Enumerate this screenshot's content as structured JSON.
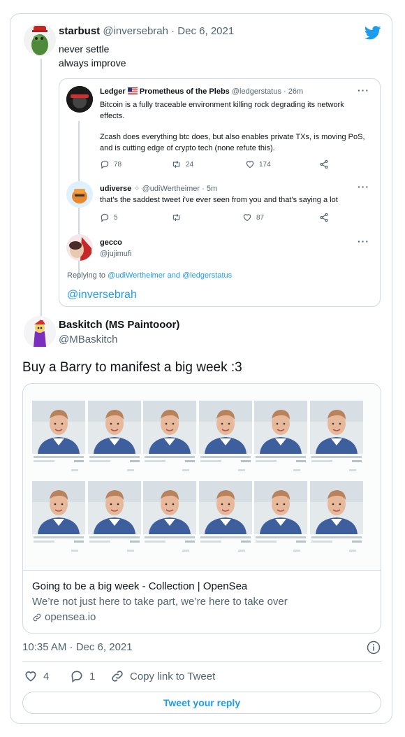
{
  "main_tweet": {
    "display_name": "starbust",
    "handle_date": "@inversebrah · Dec 6, 2021",
    "lines": [
      "never settle",
      "always improve"
    ]
  },
  "quoted_thread": {
    "tweet1": {
      "name_prefix": "Ledger",
      "name_suffix": "Prometheus of the Plebs",
      "handle_time": "@ledgerstatus · 26m",
      "text_para1": "Bitcoin is a fully traceable environment killing rock degrading its network effects.",
      "text_para2": "Zcash does everything btc does, but also enables private TXs, is moving PoS, and is cutting edge of crypto tech (none refute this).",
      "replies": "78",
      "retweets": "24",
      "likes": "174"
    },
    "tweet2": {
      "name": "udiverse",
      "handle_time": "@udiWertheimer · 5m",
      "text": "that's the saddest tweet i've ever seen from you and that's saying a lot",
      "replies": "5",
      "likes": "87"
    },
    "tweet3": {
      "name": "gecco",
      "handle": "@jujimufi",
      "replying_prefix": "Replying to",
      "replying_users": "@udiWertheimer and @ledgerstatus",
      "mention": "@inversebrah"
    }
  },
  "reply_tweet": {
    "display_name": "Baskitch (MS Paintooor)",
    "handle": "@MBaskitch",
    "text": "Buy a Barry to manifest a big week :3"
  },
  "link_card": {
    "title": "Going to be a big week - Collection | OpenSea",
    "description": "We’re not just here to take part, we’re here to take over",
    "domain": "opensea.io"
  },
  "footer": {
    "timestamp": "10:35 AM · Dec 6, 2021",
    "likes": "4",
    "replies": "1",
    "copy_link": "Copy link to Tweet",
    "reply_button": "Tweet your reply"
  },
  "icons": {
    "brand": "twitter-bird-icon",
    "info": "info-icon",
    "more": "more-dots-icon"
  },
  "colors": {
    "accent": "#1d9bf0",
    "text": "#0f1419",
    "muted": "#536471",
    "border": "#cfd9de"
  }
}
